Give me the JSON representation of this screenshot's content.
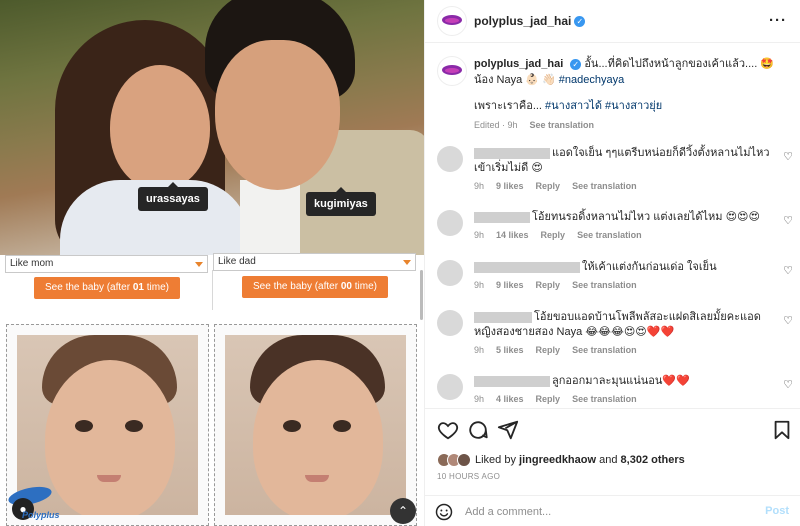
{
  "left": {
    "tags": {
      "left": "urassayas",
      "right": "kugimiyas"
    },
    "selects": {
      "left": "Like mom",
      "right": "Like dad"
    },
    "buttons": {
      "left": {
        "prefix": "See the baby (after ",
        "count": "01",
        "suffix": " time)"
      },
      "right": {
        "prefix": "See the baby (after ",
        "count": "00",
        "suffix": " time)"
      }
    },
    "logo_text": "Polyplus",
    "scroll_up_icon": "chevron-up-icon"
  },
  "post": {
    "header": {
      "username": "polyplus_jad_hai",
      "more_icon": "more-icon"
    },
    "caption": {
      "username": "polyplus_jad_hai",
      "text_a": "อั้น...ที่คิดไปถึงหน้าลูกของเค้าแล้ว.... 🤩 น้อง Naya 👶🏻 👋🏻 ",
      "hashtag_a": "#nadechyaya",
      "text_b": "เพราะเราคือ... ",
      "hashtag_b": "#นางสาวได้",
      "hashtag_c": "#นางสาวยุ่ย",
      "edited": "Edited · 9h",
      "see_translation": "See translation"
    },
    "comments": [
      {
        "text": "แอดใจเย็น ๆๆแตรีบหน่อยก็ดีวิ้งตั้งหลานไม่ไหวเข้าเริ่มไม่ดี 😍",
        "time": "9h",
        "likes": "9 likes",
        "reply": "Reply",
        "translate": "See translation"
      },
      {
        "text": "โอ้ยทนรอดิ้งหลานไม่ไหว แต่งเลยได้ไหม 😍😍😍",
        "time": "9h",
        "likes": "14 likes",
        "reply": "Reply",
        "translate": "See translation"
      },
      {
        "text": "ให้เค้าแต่งกันก่อนเด่อ ใจเย็น",
        "time": "9h",
        "likes": "9 likes",
        "reply": "Reply",
        "translate": "See translation"
      },
      {
        "text": "โอ้ยขอบแอดบ้านโพลีพลัสอะแฝดสิเลยมั้ยคะแอดหญิงสองชายสอง Naya 😂😂😂😍😍❤️❤️",
        "time": "9h",
        "likes": "5 likes",
        "reply": "Reply",
        "translate": "See translation"
      },
      {
        "text": "ลูกออกมาละมุนแน่นอน❤️❤️",
        "time": "9h",
        "likes": "4 likes",
        "reply": "Reply",
        "translate": "See translation"
      }
    ],
    "liked_by": {
      "prefix": "Liked by ",
      "user": "jingreedkhaow",
      "middle": " and ",
      "others": "8,302 others"
    },
    "time_ago": "10 HOURS AGO",
    "add_comment": {
      "placeholder": "Add a comment...",
      "post_label": "Post"
    }
  },
  "colors": {
    "accent_orange": "#ee7d34",
    "link_blue": "#00376b",
    "verified_blue": "#3897f0"
  }
}
